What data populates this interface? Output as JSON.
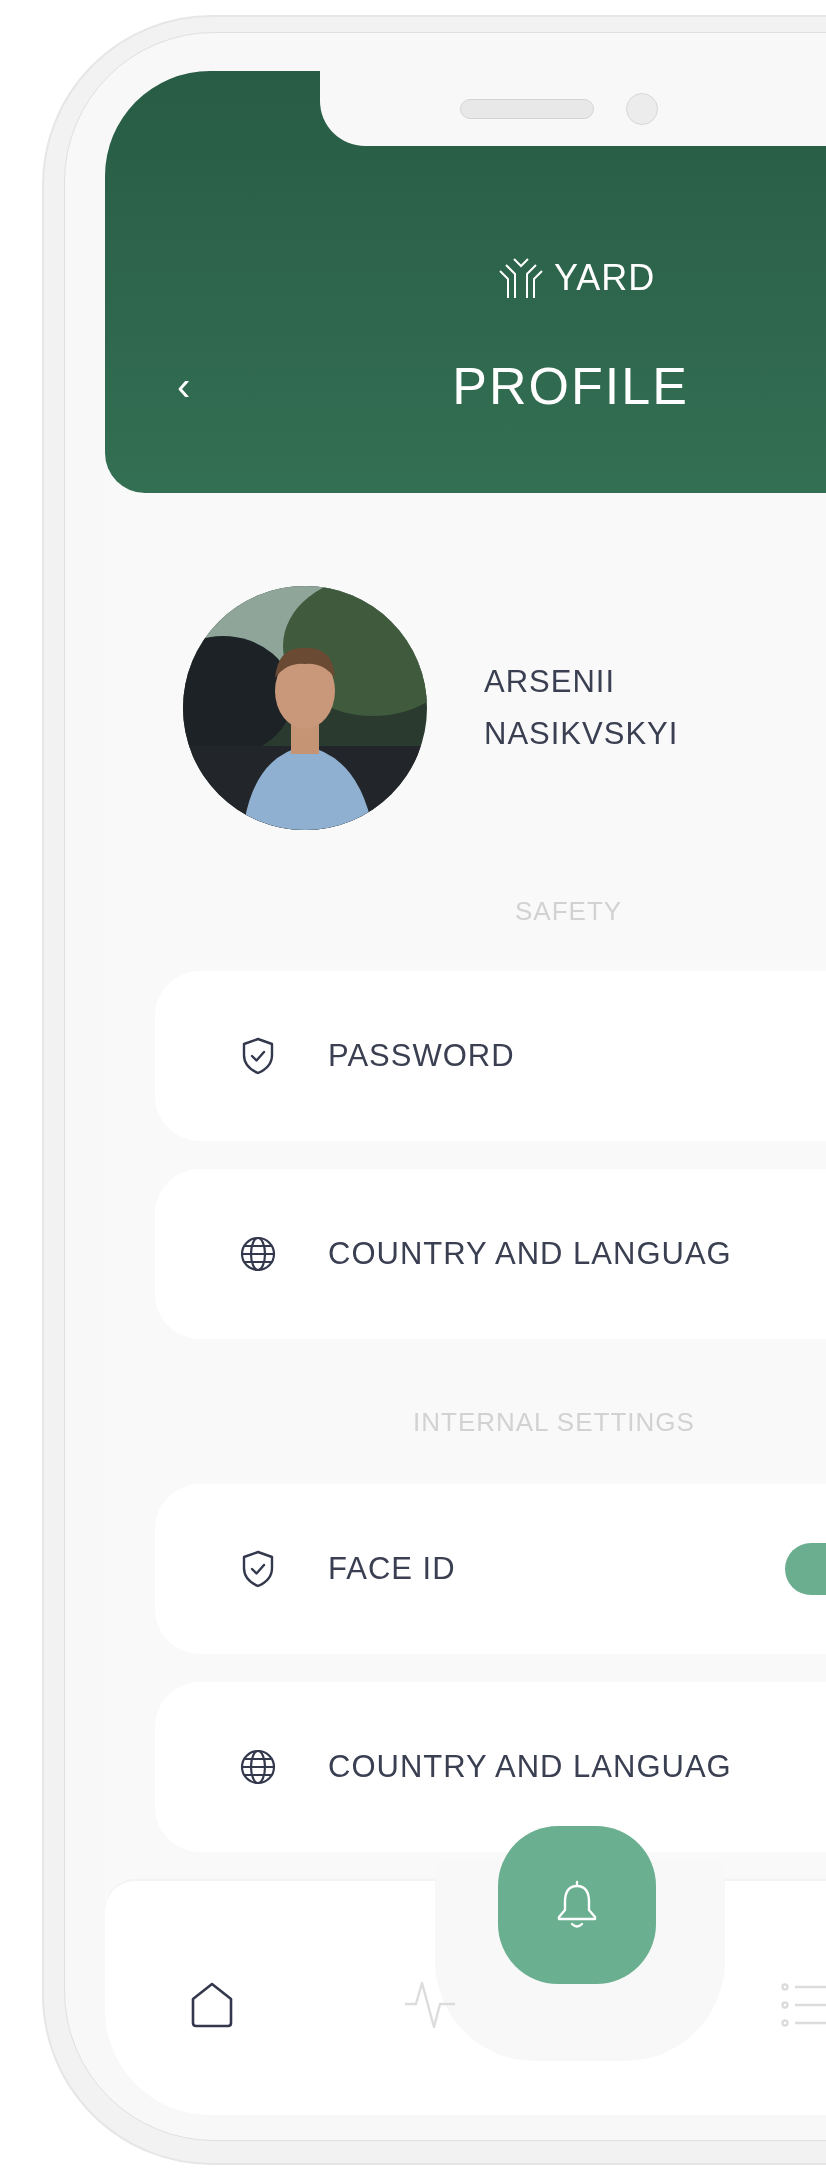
{
  "header": {
    "logo": "YARD",
    "title": "PROFILE",
    "back": "‹"
  },
  "profile": {
    "name_lines": [
      "ARSENII",
      "NASIKVSKYI"
    ]
  },
  "sections": [
    {
      "title": "SAFETY",
      "items": [
        {
          "kind": "link",
          "label": "PASSWORD"
        },
        {
          "kind": "link",
          "label": "COUNTRY AND LANGUAG"
        }
      ]
    },
    {
      "title": "INTERNAL SETTINGS",
      "items": [
        {
          "kind": "toggle",
          "label": "FACE ID",
          "on": true
        },
        {
          "kind": "link",
          "label": "COUNTRY AND LANGUAG"
        }
      ]
    }
  ],
  "nav": {
    "items": [
      {
        "selected": true
      },
      {
        "selected": false
      },
      {
        "selected": false
      }
    ]
  }
}
